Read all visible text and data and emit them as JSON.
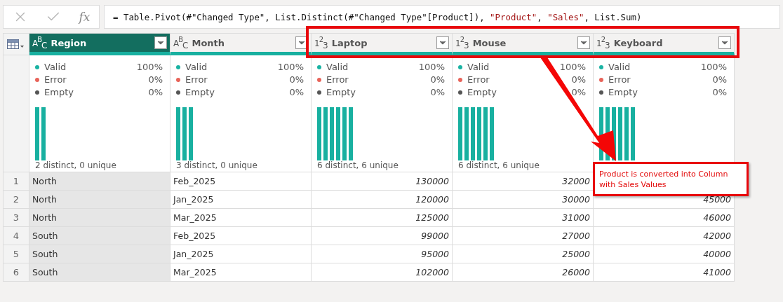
{
  "formula_bar": {
    "cancel_disabled": true,
    "confirm_disabled": true,
    "fx_label": "fx",
    "formula": [
      {
        "kind": "code",
        "text": "= Table.Pivot(#\"Changed Type\", List.Distinct(#\"Changed Type\"[Product]), "
      },
      {
        "kind": "string",
        "text": "\"Product\""
      },
      {
        "kind": "code",
        "text": ", "
      },
      {
        "kind": "string",
        "text": "\"Sales\""
      },
      {
        "kind": "code",
        "text": ", List.Sum)"
      }
    ]
  },
  "columns": [
    {
      "name": "Region",
      "type_icon": "A$^{B}$$_{C}$",
      "selected": true,
      "kind": "text",
      "footer": "2 distinct, 0 unique",
      "bars": [
        {
          "kind": "bar"
        },
        {
          "kind": "bar"
        }
      ],
      "stats": [
        {
          "label": "Valid",
          "value": "100%",
          "color": "#1ab3a3"
        },
        {
          "label": "Error",
          "value": "0%",
          "color": "#e8645a"
        },
        {
          "label": "Empty",
          "value": "0%",
          "color": "#555555"
        }
      ]
    },
    {
      "name": "Month",
      "type_icon": "A$^{B}$$_{C}$",
      "selected": false,
      "kind": "text",
      "footer": "3 distinct, 0 unique",
      "bars": [
        {
          "kind": "bar"
        },
        {
          "kind": "bar"
        },
        {
          "kind": "bar"
        }
      ],
      "stats": [
        {
          "label": "Valid",
          "value": "100%",
          "color": "#1ab3a3"
        },
        {
          "label": "Error",
          "value": "0%",
          "color": "#e8645a"
        },
        {
          "label": "Empty",
          "value": "0%",
          "color": "#555555"
        }
      ]
    },
    {
      "name": "Laptop",
      "type_icon": "1$^{2}$$_{3}$",
      "selected": false,
      "kind": "number",
      "footer": "6 distinct, 6 unique",
      "bars": [
        {
          "kind": "bar"
        },
        {
          "kind": "bar"
        },
        {
          "kind": "bar"
        },
        {
          "kind": "bar"
        },
        {
          "kind": "bar"
        },
        {
          "kind": "bar"
        }
      ],
      "stats": [
        {
          "label": "Valid",
          "value": "100%",
          "color": "#1ab3a3"
        },
        {
          "label": "Error",
          "value": "0%",
          "color": "#e8645a"
        },
        {
          "label": "Empty",
          "value": "0%",
          "color": "#555555"
        }
      ]
    },
    {
      "name": "Mouse",
      "type_icon": "1$^{2}$$_{3}$",
      "selected": false,
      "kind": "number",
      "footer": "6 distinct, 6 unique",
      "bars": [
        {
          "kind": "bar"
        },
        {
          "kind": "bar"
        },
        {
          "kind": "bar"
        },
        {
          "kind": "bar"
        },
        {
          "kind": "bar"
        },
        {
          "kind": "bar"
        }
      ],
      "stats": [
        {
          "label": "Valid",
          "value": "100%",
          "color": "#1ab3a3"
        },
        {
          "label": "Error",
          "value": "0%",
          "color": "#e8645a"
        },
        {
          "label": "Empty",
          "value": "0%",
          "color": "#555555"
        }
      ]
    },
    {
      "name": "Keyboard",
      "type_icon": "1$^{2}$$_{3}$",
      "selected": false,
      "kind": "number",
      "bars": [
        {
          "kind": "bar"
        },
        {
          "kind": "bar"
        },
        {
          "kind": "bar"
        },
        {
          "kind": "bar"
        },
        {
          "kind": "bar"
        },
        {
          "kind": "bar"
        }
      ],
      "stats": [
        {
          "label": "Valid",
          "value": "100%",
          "color": "#1ab3a3"
        },
        {
          "label": "Error",
          "value": "0%",
          "color": "#e8645a"
        },
        {
          "label": "Empty",
          "value": "0%",
          "color": "#555555"
        }
      ]
    }
  ],
  "rows": [
    {
      "number": "1",
      "cells": [
        "North",
        "Feb_2025",
        "130000",
        "32000",
        null
      ]
    },
    {
      "number": "2",
      "cells": [
        "North",
        "Jan_2025",
        "120000",
        "30000",
        "45000"
      ]
    },
    {
      "number": "3",
      "cells": [
        "North",
        "Mar_2025",
        "125000",
        "31000",
        "46000"
      ]
    },
    {
      "number": "4",
      "cells": [
        "South",
        "Feb_2025",
        "99000",
        "27000",
        "42000"
      ]
    },
    {
      "number": "5",
      "cells": [
        "South",
        "Jan_2025",
        "95000",
        "25000",
        "40000"
      ]
    },
    {
      "number": "6",
      "cells": [
        "South",
        "Mar_2025",
        "102000",
        "26000",
        "41000"
      ]
    }
  ],
  "callout": {
    "text": "Product is converted into Column with Sales Values"
  }
}
